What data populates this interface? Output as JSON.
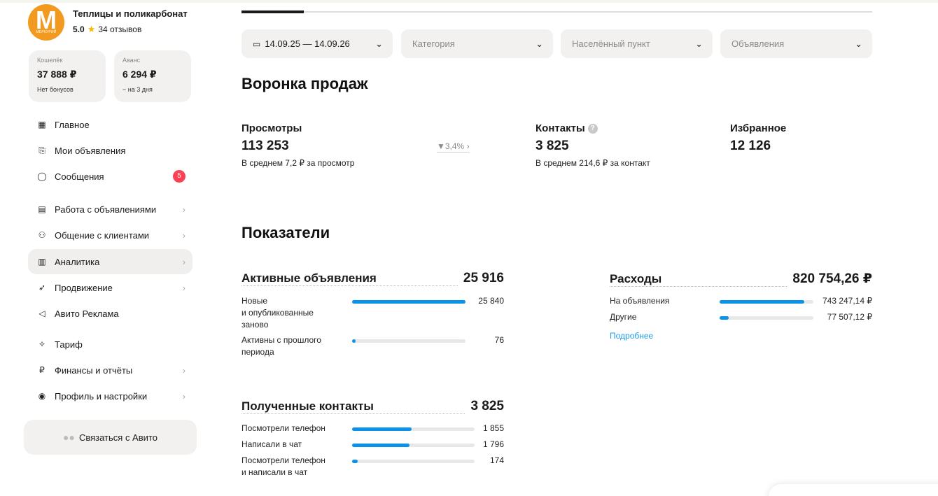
{
  "brand": {
    "logo_letter": "M",
    "logo_sub": "МЕРКУРИЙ",
    "name": "Теплицы и поликарбонат",
    "rating": "5.0",
    "reviews": "34 отзывов"
  },
  "wallets": [
    {
      "label": "Кошелёк",
      "amount": "37 888 ₽",
      "note": "Нет бонусов"
    },
    {
      "label": "Аванс",
      "amount": "6 294 ₽",
      "note": "~ на 3 дня"
    }
  ],
  "nav": [
    {
      "label": "Главное",
      "icon": "grid-icon",
      "glyph": "▦"
    },
    {
      "label": "Мои объявления",
      "icon": "listing-icon",
      "glyph": "⎘"
    },
    {
      "label": "Сообщения",
      "icon": "chat-icon",
      "glyph": "◯",
      "badge": "5"
    },
    {
      "label": "Работа с объявлениями",
      "icon": "ads-work-icon",
      "glyph": "▤"
    },
    {
      "label": "Общение с клиентами",
      "icon": "clients-icon",
      "glyph": "⚇"
    },
    {
      "label": "Аналитика",
      "icon": "analytics-icon",
      "glyph": "▥"
    },
    {
      "label": "Продвижение",
      "icon": "rocket-icon",
      "glyph": "➶"
    },
    {
      "label": "Авито Реклама",
      "icon": "megaphone-icon",
      "glyph": "◁"
    },
    {
      "label": "Тариф",
      "icon": "tariff-icon",
      "glyph": "✧"
    },
    {
      "label": "Финансы и отчёты",
      "icon": "ruble-icon",
      "glyph": "₽"
    },
    {
      "label": "Профиль и настройки",
      "icon": "profile-icon",
      "glyph": "◉"
    }
  ],
  "contact_button": "Связаться с Авито",
  "filters": {
    "date": "14.09.25 — 14.09.26",
    "category": "Категория",
    "locality": "Населённый пункт",
    "ads": "Объявления"
  },
  "funnel": {
    "title": "Воронка продаж",
    "views": {
      "title": "Просмотры",
      "value": "113 253",
      "sub": "В среднем 7,2 ₽ за просмотр",
      "trend": "▼3,4% ›"
    },
    "contacts": {
      "title": "Контакты",
      "value": "3 825",
      "sub": "В среднем 214,6 ₽ за контакт"
    },
    "favorites": {
      "title": "Избранное",
      "value": "12 126"
    }
  },
  "indicators": {
    "title": "Показатели",
    "active": {
      "title": "Активные объявления",
      "value": "25 916",
      "rows": [
        {
          "label": "Новые\nи опубликованные\nзаново",
          "value": "25 840",
          "fraction": 0.997
        },
        {
          "label": "Активны с прошлого\nпериода",
          "value": "76",
          "fraction": 0.02
        }
      ]
    },
    "expenses": {
      "title": "Расходы",
      "value": "820 754,26 ₽",
      "rows": [
        {
          "label": "На объявления",
          "value": "743 247,14 ₽",
          "fraction": 0.906
        },
        {
          "label": "Другие",
          "value": "77 507,12 ₽",
          "fraction": 0.094
        }
      ],
      "more": "Подробнее"
    },
    "contacts": {
      "title": "Полученные контакты",
      "value": "3 825",
      "rows": [
        {
          "label": "Посмотрели телефон",
          "value": "1 855",
          "fraction": 0.485
        },
        {
          "label": "Написали в чат",
          "value": "1 796",
          "fraction": 0.47
        },
        {
          "label": "Посмотрели телефон\nи написали в чат",
          "value": "174",
          "fraction": 0.045
        }
      ]
    }
  }
}
